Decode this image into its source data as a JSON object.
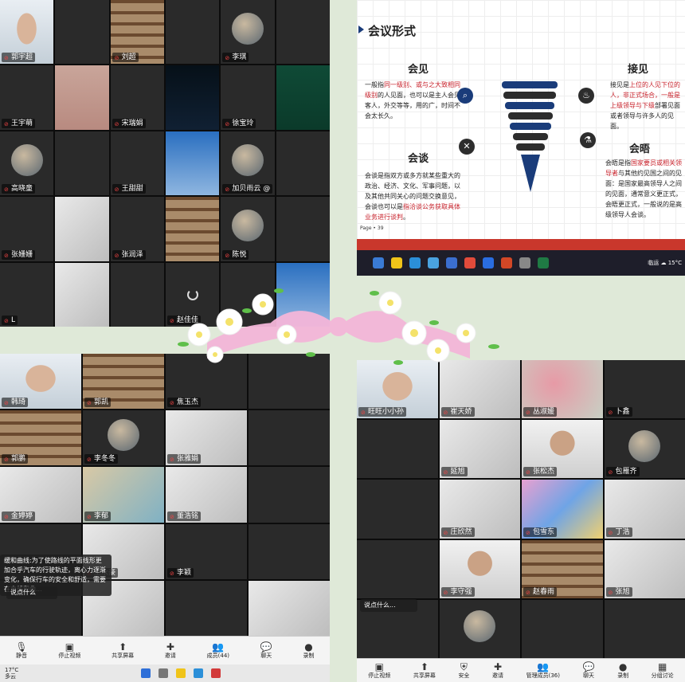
{
  "q1": {
    "participants": [
      {
        "name": "郭宇超",
        "cam": "woman",
        "mic": true
      },
      {
        "name": "",
        "cam": "dark"
      },
      {
        "name": "刘超",
        "cam": "shelf"
      },
      {
        "name": "",
        "cam": "dark"
      },
      {
        "name": "李琪",
        "cam": "avatar"
      },
      {
        "name": "",
        "cam": "dark"
      },
      {
        "name": "王宇萌",
        "cam": "dark"
      },
      {
        "name": "",
        "cam": "skin"
      },
      {
        "name": "宋瑞娟",
        "cam": "dark"
      },
      {
        "name": "",
        "cam": "night"
      },
      {
        "name": "徐宝玲",
        "cam": "dark"
      },
      {
        "name": "",
        "cam": "board"
      },
      {
        "name": "高晓童",
        "cam": "avatar"
      },
      {
        "name": "",
        "cam": "dark"
      },
      {
        "name": "王甜甜",
        "cam": "dark"
      },
      {
        "name": "",
        "cam": "blue"
      },
      {
        "name": "加贝雨云 @",
        "cam": "avatar"
      },
      {
        "name": "",
        "cam": "dark"
      },
      {
        "name": "张姗姗",
        "cam": "dark"
      },
      {
        "name": "",
        "cam": "light"
      },
      {
        "name": "张润泽",
        "cam": "dark"
      },
      {
        "name": "",
        "cam": "shelf"
      },
      {
        "name": "陈悦",
        "cam": "avatar"
      },
      {
        "name": "",
        "cam": "dark"
      },
      {
        "name": "L",
        "cam": "dark"
      },
      {
        "name": "",
        "cam": "light"
      },
      {
        "name": "",
        "cam": "dark"
      },
      {
        "name": "赵佳佳",
        "cam": "spinner"
      },
      {
        "name": "",
        "cam": "dark"
      },
      {
        "name": "",
        "cam": "blue"
      }
    ]
  },
  "slide": {
    "title": "会议形式",
    "huijian_h": "会见",
    "huijian_t1": "一般指",
    "huijian_r1": "同一级别、或与之大致相同级别",
    "huijian_t2": "的人见面，也可以是主人会见客人，外交等等，用的广，时间不会太长久。",
    "jiejian_h": "接见",
    "jiejian_t1": "接见是",
    "jiejian_r1": "上位的人见下位的人，非正式场合，一般是上级领导与下级",
    "jiejian_t2": "部署见面或者领导与许多人的见面。",
    "huitan_h": "会谈",
    "huitan_t1": "会谈是指双方或多方就某些重大的政治、经济、文化、军事问题，以及其他共同关心的问题交换意见，会谈也可以是",
    "huitan_r1": "指洽谈公务获取具体业务进行谈判",
    "huitan_t2": "。",
    "huiwu_h": "会晤",
    "huiwu_t1": "会晤是指",
    "huiwu_r1": "国家要员或相关领导者",
    "huiwu_t2": "与其他约见国之间的见面：是国家最高领导人之间的见面，通常意义更正式，会晤更正式，一般说的是高级领导人会谈。",
    "page": "Page • 39",
    "tray": "15°C",
    "app_tray": "临运"
  },
  "q3": {
    "participants": [
      {
        "name": "韩琦",
        "cam": "woman"
      },
      {
        "name": "郭凯",
        "cam": "shelf",
        "mic": true
      },
      {
        "name": "焦玉杰",
        "cam": "dark"
      },
      {
        "name": "",
        "cam": "dark"
      },
      {
        "name": "郭鹏",
        "cam": "shelf"
      },
      {
        "name": "李冬冬",
        "cam": "avatar"
      },
      {
        "name": "张雅娟",
        "cam": "light"
      },
      {
        "name": "",
        "cam": "dark"
      },
      {
        "name": "金婷婷",
        "cam": "light"
      },
      {
        "name": "李郁",
        "cam": "beach"
      },
      {
        "name": "董浩铭",
        "cam": "light"
      },
      {
        "name": "",
        "cam": "dark"
      },
      {
        "name": "",
        "cam": "dark"
      },
      {
        "name": "王永豪",
        "cam": "light"
      },
      {
        "name": "李颖",
        "cam": "dark"
      },
      {
        "name": "",
        "cam": "dark"
      },
      {
        "name": "",
        "cam": "dark"
      },
      {
        "name": "",
        "cam": "light"
      },
      {
        "name": "",
        "cam": "dark"
      },
      {
        "name": "",
        "cam": "light"
      }
    ],
    "chat_msg": "缓和曲线:为了使路线的平面线形更加合乎汽车的行驶轨迹，离心力逐渐变化，确保行车的安全和舒适，需要在直线和曲...",
    "chat_input": "说点什么",
    "toolbar": [
      {
        "icon": "mic-icon",
        "label": "静音",
        "glyph": "🎙"
      },
      {
        "icon": "video-icon",
        "label": "停止视频",
        "glyph": "▣"
      },
      {
        "icon": "share-screen-icon",
        "label": "共享屏幕",
        "glyph": "⬆"
      },
      {
        "icon": "invite-icon",
        "label": "邀请",
        "glyph": "✚"
      },
      {
        "icon": "members-icon",
        "label": "成员(44)",
        "glyph": "👥"
      },
      {
        "icon": "chat-icon",
        "label": "聊天",
        "glyph": "💬"
      },
      {
        "icon": "record-icon",
        "label": "录制",
        "glyph": "●"
      }
    ],
    "weather_temp": "17°C",
    "weather_desc": "多云"
  },
  "q4": {
    "participants": [
      {
        "name": "旺旺小小孙",
        "cam": "woman"
      },
      {
        "name": "崔天娇",
        "cam": "light"
      },
      {
        "name": "丛淑媛",
        "cam": "flower"
      },
      {
        "name": "卜鑫",
        "cam": "dark"
      },
      {
        "name": "",
        "cam": "dark"
      },
      {
        "name": "延旭",
        "cam": "light"
      },
      {
        "name": "张松杰",
        "cam": "man"
      },
      {
        "name": "包雁齐",
        "cam": "avatar"
      },
      {
        "name": "",
        "cam": "dark"
      },
      {
        "name": "庄欣然",
        "cam": "light"
      },
      {
        "name": "包雪东",
        "cam": "colorful"
      },
      {
        "name": "丁浩",
        "cam": "light"
      },
      {
        "name": "",
        "cam": "dark"
      },
      {
        "name": "李守强",
        "cam": "man"
      },
      {
        "name": "赵春雨",
        "cam": "shelf"
      },
      {
        "name": "张旭",
        "cam": "light"
      },
      {
        "name": "",
        "cam": "dark"
      },
      {
        "name": "",
        "cam": "avatar"
      },
      {
        "name": "",
        "cam": "dark"
      },
      {
        "name": "",
        "cam": "dark"
      }
    ],
    "chat_input": "说点什么...",
    "toolbar": [
      {
        "icon": "video-icon",
        "label": "停止视频",
        "glyph": "▣"
      },
      {
        "icon": "share-screen-icon",
        "label": "共享屏幕",
        "glyph": "⬆"
      },
      {
        "icon": "security-icon",
        "label": "安全",
        "glyph": "⛨"
      },
      {
        "icon": "invite-icon",
        "label": "邀请",
        "glyph": "✚"
      },
      {
        "icon": "members-icon",
        "label": "管理成员(36)",
        "glyph": "👥"
      },
      {
        "icon": "chat-icon",
        "label": "聊天",
        "glyph": "💬"
      },
      {
        "icon": "record-icon",
        "label": "录制",
        "glyph": "●"
      },
      {
        "icon": "breakout-icon",
        "label": "分组讨论",
        "glyph": "▦"
      }
    ]
  },
  "colors": {
    "accent_red": "#c8202a",
    "slide_blue": "#1a3c7a",
    "toolbar_bg": "#f4f4f4"
  }
}
